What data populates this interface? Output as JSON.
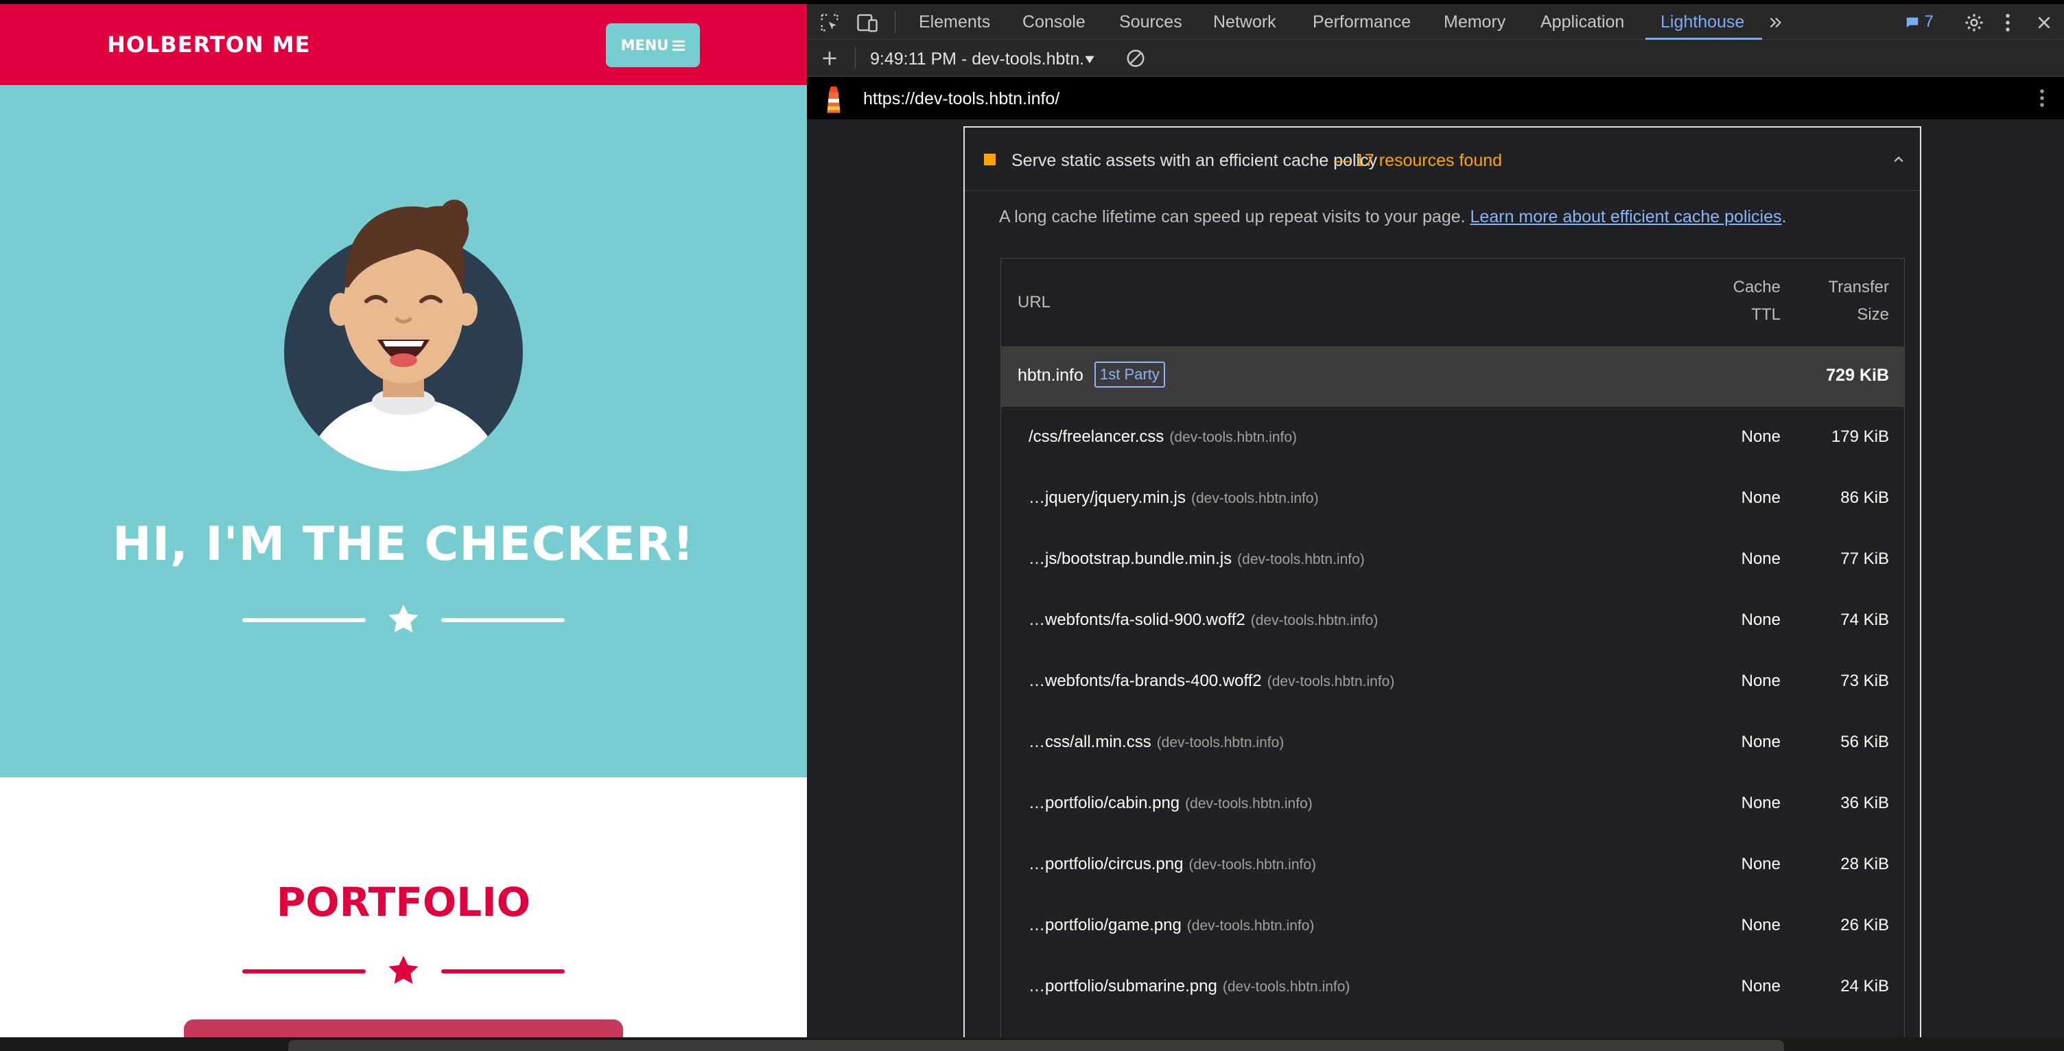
{
  "site": {
    "brand": "HOLBERTON ME",
    "menu_label": "MENU",
    "hero_title": "HI, I'M THE CHECKER!",
    "portfolio_title": "PORTFOLIO",
    "colors": {
      "primary": "#e1003e",
      "teal": "#78cdd0"
    }
  },
  "devtools": {
    "tabs": [
      "Elements",
      "Console",
      "Sources",
      "Network",
      "Performance",
      "Memory",
      "Application",
      "Lighthouse"
    ],
    "active_tab": "Lighthouse",
    "issues_count": "7",
    "report_select": "9:49:11 PM - dev-tools.hbtn.",
    "report_url": "https://dev-tools.hbtn.info/",
    "audit": {
      "title": "Serve static assets with an efficient cache policy",
      "dash": "—",
      "count": "17 resources found",
      "description": "A long cache lifetime can speed up repeat visits to your page.",
      "learn_more": "Learn more about efficient cache policies",
      "period": ".",
      "headers": {
        "url": "URL",
        "cache_1": "Cache",
        "cache_2": "TTL",
        "transfer_1": "Transfer",
        "transfer_2": "Size"
      },
      "group": {
        "name": "hbtn.info",
        "badge": "1st Party",
        "size": "729 KiB"
      },
      "rows": [
        {
          "url": "/css/freelancer.css",
          "host": "(dev-tools.hbtn.info)",
          "ttl": "None",
          "size": "179 KiB"
        },
        {
          "url": "…jquery/jquery.min.js",
          "host": "(dev-tools.hbtn.info)",
          "ttl": "None",
          "size": "86 KiB"
        },
        {
          "url": "…js/bootstrap.bundle.min.js",
          "host": "(dev-tools.hbtn.info)",
          "ttl": "None",
          "size": "77 KiB"
        },
        {
          "url": "…webfonts/fa-solid-900.woff2",
          "host": "(dev-tools.hbtn.info)",
          "ttl": "None",
          "size": "74 KiB"
        },
        {
          "url": "…webfonts/fa-brands-400.woff2",
          "host": "(dev-tools.hbtn.info)",
          "ttl": "None",
          "size": "73 KiB"
        },
        {
          "url": "…css/all.min.css",
          "host": "(dev-tools.hbtn.info)",
          "ttl": "None",
          "size": "56 KiB"
        },
        {
          "url": "…portfolio/cabin.png",
          "host": "(dev-tools.hbtn.info)",
          "ttl": "None",
          "size": "36 KiB"
        },
        {
          "url": "…portfolio/circus.png",
          "host": "(dev-tools.hbtn.info)",
          "ttl": "None",
          "size": "28 KiB"
        },
        {
          "url": "…portfolio/game.png",
          "host": "(dev-tools.hbtn.info)",
          "ttl": "None",
          "size": "26 KiB"
        },
        {
          "url": "…portfolio/submarine.png",
          "host": "(dev-tools.hbtn.info)",
          "ttl": "None",
          "size": "24 KiB"
        }
      ]
    },
    "colors": {
      "accent": "#7cacf8",
      "warning": "#ffa400"
    }
  }
}
